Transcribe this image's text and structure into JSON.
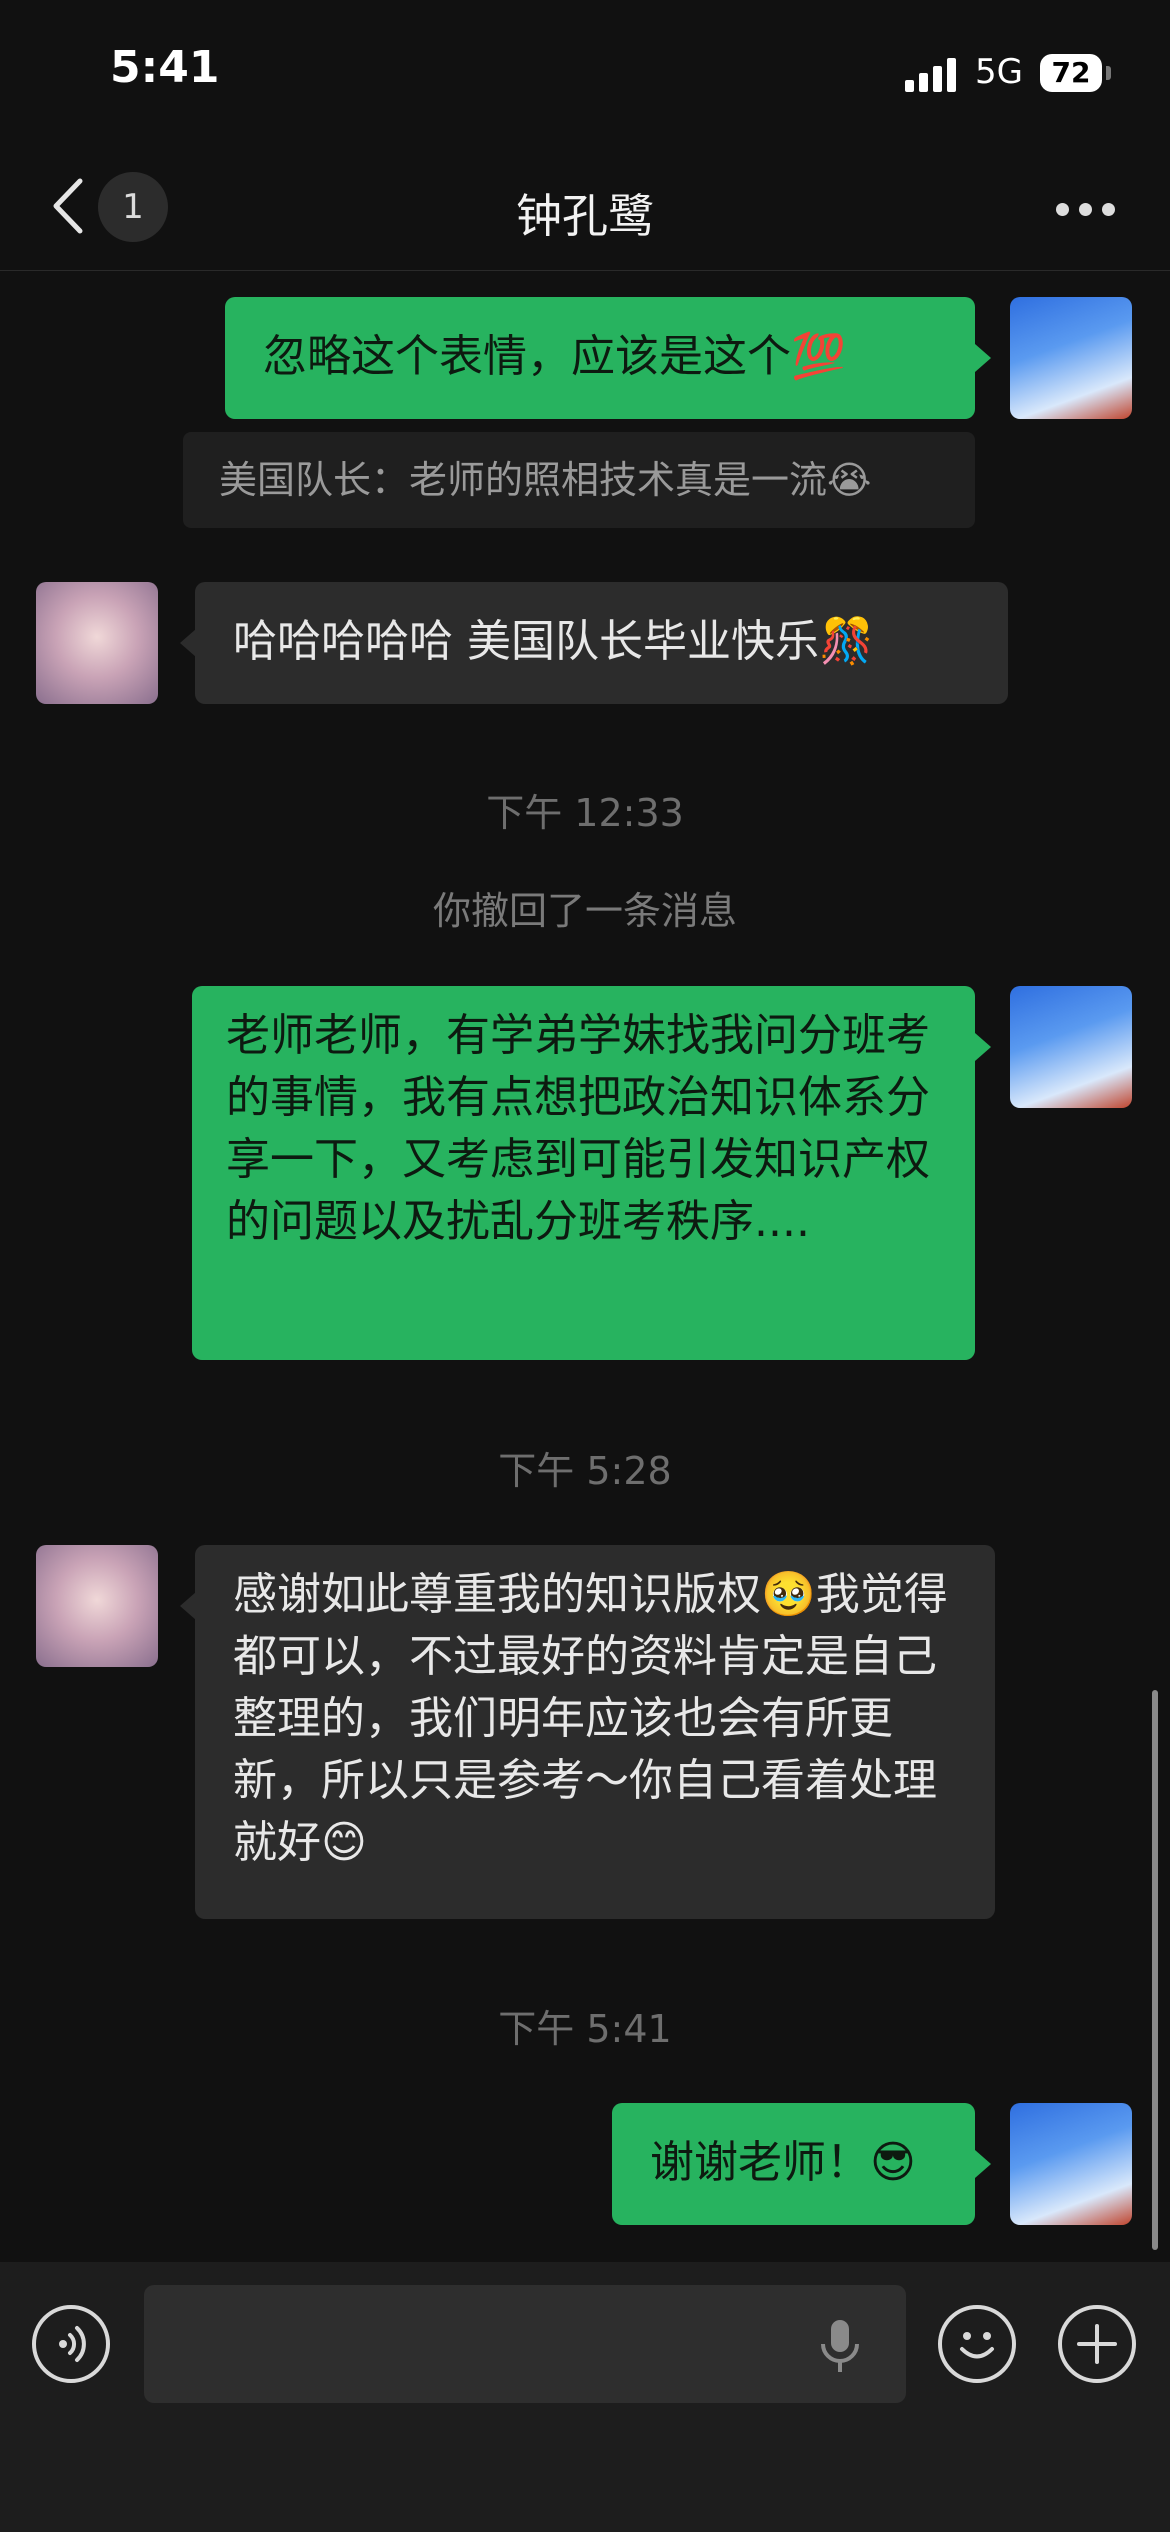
{
  "status": {
    "time": "5:41",
    "network": "5G",
    "battery": "72"
  },
  "nav": {
    "unread_badge": "1",
    "title": "钟孔鹭"
  },
  "messages": {
    "m1": "忽略这个表情，应该是这个💯",
    "quote": "美国队长：老师的照相技术真是一流😭",
    "m2": "哈哈哈哈哈 美国队长毕业快乐🎊",
    "time1": "下午 12:33",
    "recall": "你撤回了一条消息",
    "m3": "老师老师，有学弟学妹找我问分班考的事情，我有点想把政治知识体系分享一下，又考虑到可能引发知识产权的问题以及扰乱分班考秩序....",
    "time2": "下午 5:28",
    "m4": "感谢如此尊重我的知识版权🥹我觉得都可以，不过最好的资料肯定是自己整理的，我们明年应该也会有所更新，所以只是参考～你自己看着处理就好😊",
    "time3": "下午 5:41",
    "m5": "谢谢老师！😎"
  },
  "input": {
    "placeholder": ""
  },
  "icons": {
    "back": "chevron-left-icon",
    "more": "more-dots-icon",
    "voice": "voice-toggle-icon",
    "mic": "mic-icon",
    "emoji": "emoji-icon",
    "plus": "plus-icon"
  },
  "colors": {
    "outgoing_bubble": "#27b35f",
    "incoming_bubble": "#2c2c2c",
    "background": "#111111"
  }
}
